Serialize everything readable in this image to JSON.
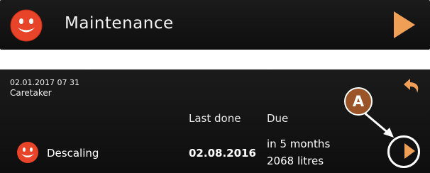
{
  "header": {
    "title": "Maintenance",
    "status_icon": "smiley-face-icon",
    "next_icon": "play-arrow-icon",
    "accent_color": "#f0a056",
    "status_color": "#e8442a"
  },
  "detail": {
    "timestamp": "02.01.2017 07 31",
    "user_role": "Caretaker",
    "columns": {
      "last_done": "Last done",
      "due": "Due"
    },
    "rows": [
      {
        "label": "Descaling",
        "status_icon": "smiley-face-icon",
        "last_done": "02.08.2016",
        "due_time": "in 5 months",
        "due_volume": "2068 litres"
      }
    ],
    "back_icon": "back-arrow-icon",
    "row_action_icon": "play-button-icon",
    "callout_label": "A"
  }
}
